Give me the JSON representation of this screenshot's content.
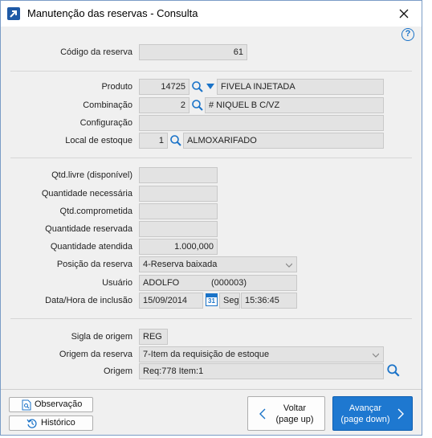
{
  "window": {
    "title": "Manutenção das reservas - Consulta",
    "help_icon": "question-circle-icon",
    "help_label": "?"
  },
  "reserva": {
    "codigo_label": "Código da reserva",
    "codigo_value": "61"
  },
  "produto": {
    "produto_label": "Produto",
    "produto_code": "14725",
    "produto_name": "FIVELA INJETADA",
    "combinacao_label": "Combinação",
    "combinacao_code": "2",
    "combinacao_name": "# NIQUEL B C/VZ",
    "configuracao_label": "Configuração",
    "configuracao_value": "",
    "local_label": "Local de estoque",
    "local_code": "1",
    "local_name": "ALMOXARIFADO"
  },
  "quantidades": {
    "qtd_livre_label": "Qtd.livre (disponível)",
    "qtd_livre_value": "",
    "qtd_necessaria_label": "Quantidade necessária",
    "qtd_necessaria_value": "",
    "qtd_comprometida_label": "Qtd.comprometida",
    "qtd_comprometida_value": "",
    "qtd_reservada_label": "Quantidade reservada",
    "qtd_reservada_value": "",
    "qtd_atendida_label": "Quantidade atendida",
    "qtd_atendida_value": "1.000,000",
    "posicao_label": "Posição da reserva",
    "posicao_value": "4-Reserva baixada",
    "usuario_label": "Usuário",
    "usuario_name": "ADOLFO",
    "usuario_code": "(000003)",
    "datahora_label": "Data/Hora de inclusão",
    "data_value": "15/09/2014",
    "calendar_day": "31",
    "weekday_value": "Seg",
    "hora_value": "15:36:45"
  },
  "origem": {
    "sigla_label": "Sigla de origem",
    "sigla_value": "REG",
    "origem_reserva_label": "Origem da reserva",
    "origem_reserva_value": "7-Item da requisição de estoque",
    "origem_label": "Origem",
    "origem_value": "Req:778 Item:1"
  },
  "footer": {
    "observacao_label": "Observação",
    "historico_label": "Histórico",
    "voltar_line1": "Voltar",
    "voltar_line2": "(page up)",
    "avancar_line1": "Avançar",
    "avancar_line2": "(page down)"
  },
  "colors": {
    "accent": "#1a73c8",
    "primary_button": "#1e78d0"
  }
}
